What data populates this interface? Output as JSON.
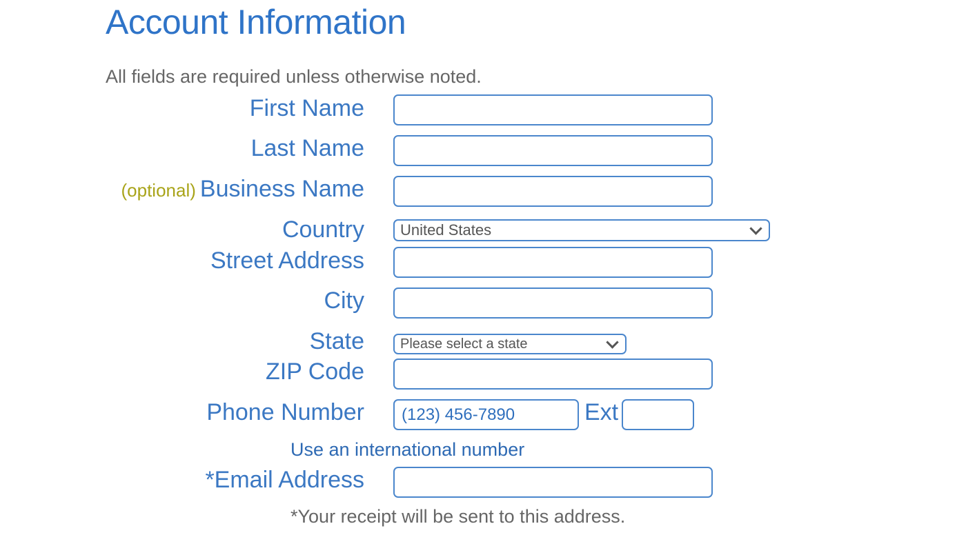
{
  "page": {
    "title": "Account Information",
    "required_note": "All fields are required unless otherwise noted."
  },
  "form": {
    "first_name": {
      "label": "First Name",
      "value": ""
    },
    "last_name": {
      "label": "Last Name",
      "value": ""
    },
    "business_name": {
      "optional_tag": "(optional)",
      "label": "Business Name",
      "value": ""
    },
    "country": {
      "label": "Country",
      "selected": "United States"
    },
    "street_address": {
      "label": "Street Address",
      "value": ""
    },
    "city": {
      "label": "City",
      "value": ""
    },
    "state": {
      "label": "State",
      "selected": "Please select a state"
    },
    "zip": {
      "label": "ZIP Code",
      "value": ""
    },
    "phone": {
      "label": "Phone Number",
      "placeholder": "(123) 456-7890",
      "ext_label": "Ext",
      "ext_value": ""
    },
    "international_link": "Use an international number",
    "email": {
      "label": "*Email Address",
      "value": ""
    },
    "receipt_note": "*Your receipt will be sent to this address."
  },
  "colors": {
    "accent": "#2f74c8",
    "label": "#3b78c3",
    "optional": "#a9a41a",
    "border": "#4a86cc"
  }
}
